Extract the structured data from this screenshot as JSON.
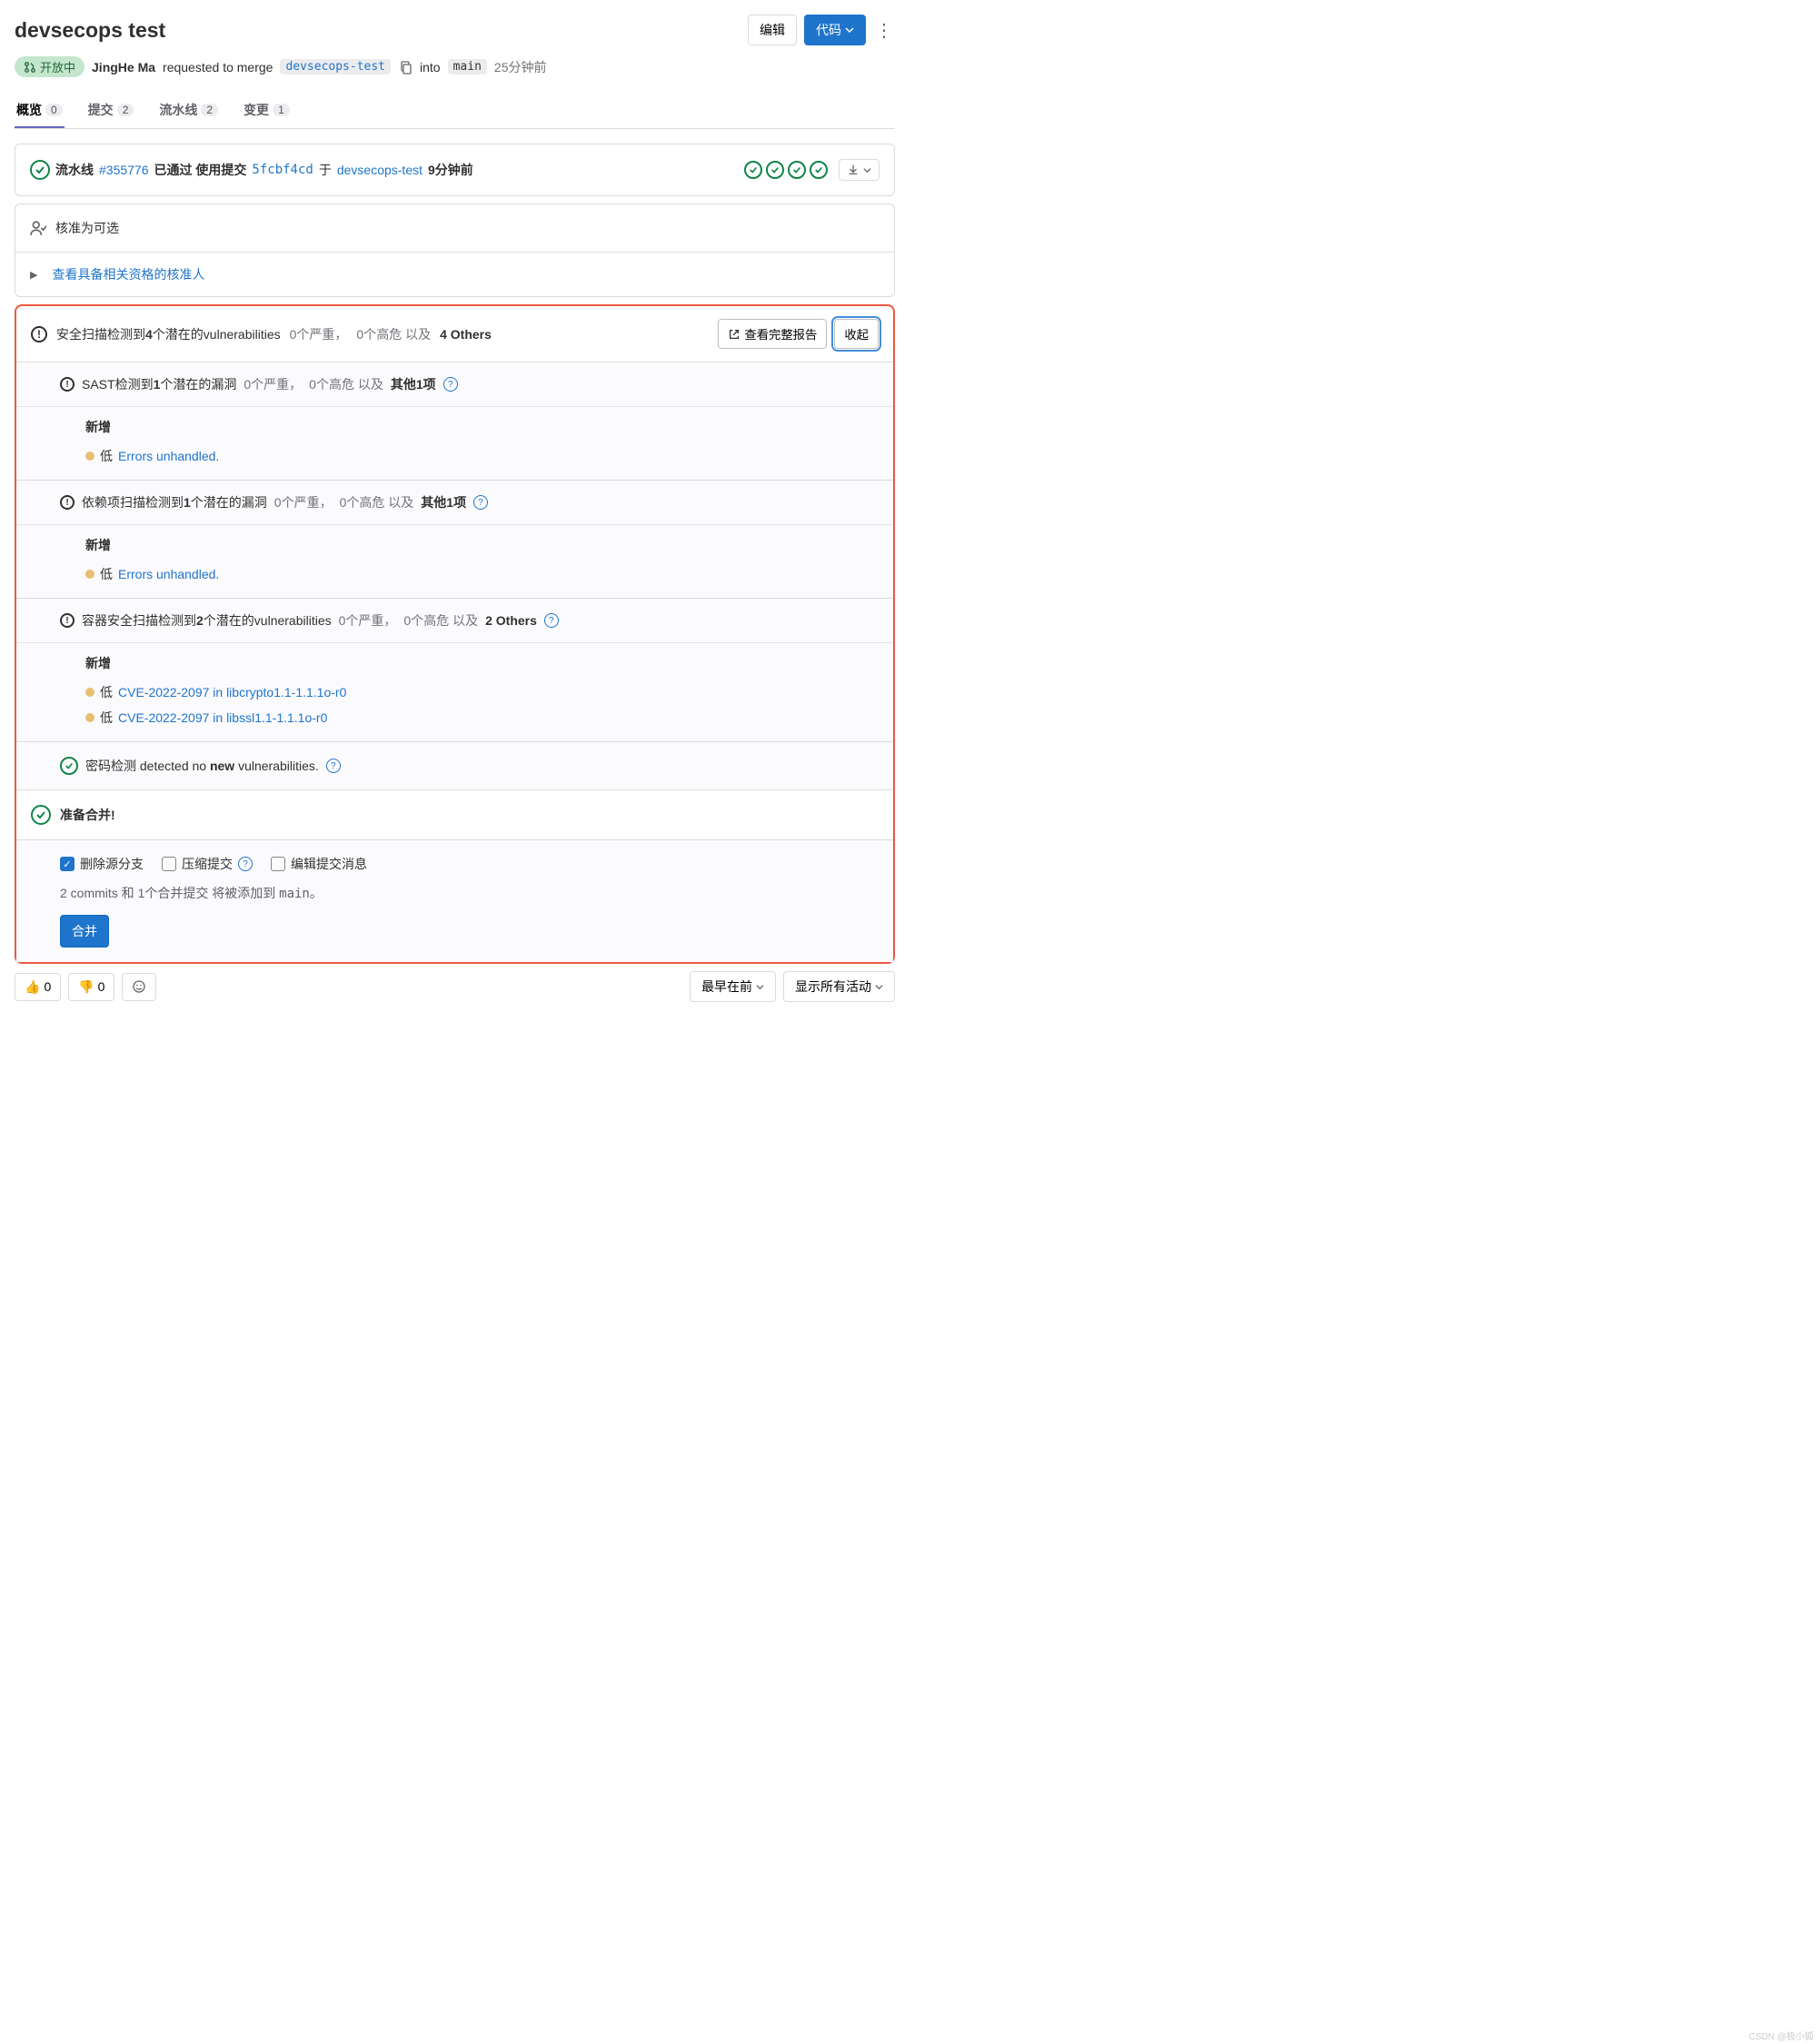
{
  "header": {
    "title": "devsecops test",
    "edit": "编辑",
    "code": "代码"
  },
  "meta": {
    "open_status": "开放中",
    "author": "JingHe Ma",
    "requested": "requested to merge",
    "source_branch": "devsecops-test",
    "into": "into",
    "target_branch": "main",
    "time": "25分钟前"
  },
  "tabs": {
    "overview": {
      "label": "概览",
      "count": "0"
    },
    "commits": {
      "label": "提交",
      "count": "2"
    },
    "pipelines": {
      "label": "流水线",
      "count": "2"
    },
    "changes": {
      "label": "变更",
      "count": "1"
    }
  },
  "pipeline": {
    "prefix": "流水线",
    "id": "#355776",
    "passed": "已通过 使用提交",
    "sha": "5fcbf4cd",
    "on": "于",
    "branch": "devsecops-test",
    "time": "9分钟前"
  },
  "approval": {
    "optional": "核准为可选",
    "view_eligible": "查看具备相关资格的核准人"
  },
  "security": {
    "summary_pre": "安全扫描检测到",
    "summary_count": "4",
    "summary_post": "个潜在的vulnerabilities",
    "critical": "0个严重，",
    "high": "0个高危 以及",
    "others": "4 Others",
    "full_report": "查看完整报告",
    "collapse": "收起",
    "sections": {
      "sast": {
        "pre": "SAST检测到",
        "count": "1",
        "post": "个潜在的漏洞",
        "crit": "0个严重，",
        "high": "0个高危 以及",
        "others": "其他1项",
        "new": "新增",
        "item1_sev": "低",
        "item1_text": "Errors unhandled."
      },
      "dep": {
        "pre": "依赖项扫描检测到",
        "count": "1",
        "post": "个潜在的漏洞",
        "crit": "0个严重，",
        "high": "0个高危 以及",
        "others": "其他1项",
        "new": "新增",
        "item1_sev": "低",
        "item1_text": "Errors unhandled."
      },
      "container": {
        "pre": "容器安全扫描检测到",
        "count": "2",
        "post": "个潜在的vulnerabilities",
        "crit": "0个严重，",
        "high": "0个高危 以及",
        "others": "2 Others",
        "new": "新增",
        "item1_sev": "低",
        "item1_text": "CVE-2022-2097 in libcrypto1.1-1.1.1o-r0",
        "item2_sev": "低",
        "item2_text": "CVE-2022-2097 in libssl1.1-1.1.1o-r0"
      },
      "secret": {
        "pre": "密码检测 detected no ",
        "bold": "new",
        "post": " vulnerabilities."
      }
    }
  },
  "merge": {
    "ready": "准备合并!",
    "delete_source": "删除源分支",
    "squash": "压缩提交",
    "edit_msg": "编辑提交消息",
    "note_pre": "2 commits 和 1个合并提交 将被添加到 ",
    "note_branch": "main",
    "note_post": "。",
    "button": "合并"
  },
  "footer": {
    "thumbs_up": "0",
    "thumbs_down": "0",
    "sort": "最早在前",
    "activity": "显示所有活动"
  },
  "watermark": "CSDN @极小狐"
}
